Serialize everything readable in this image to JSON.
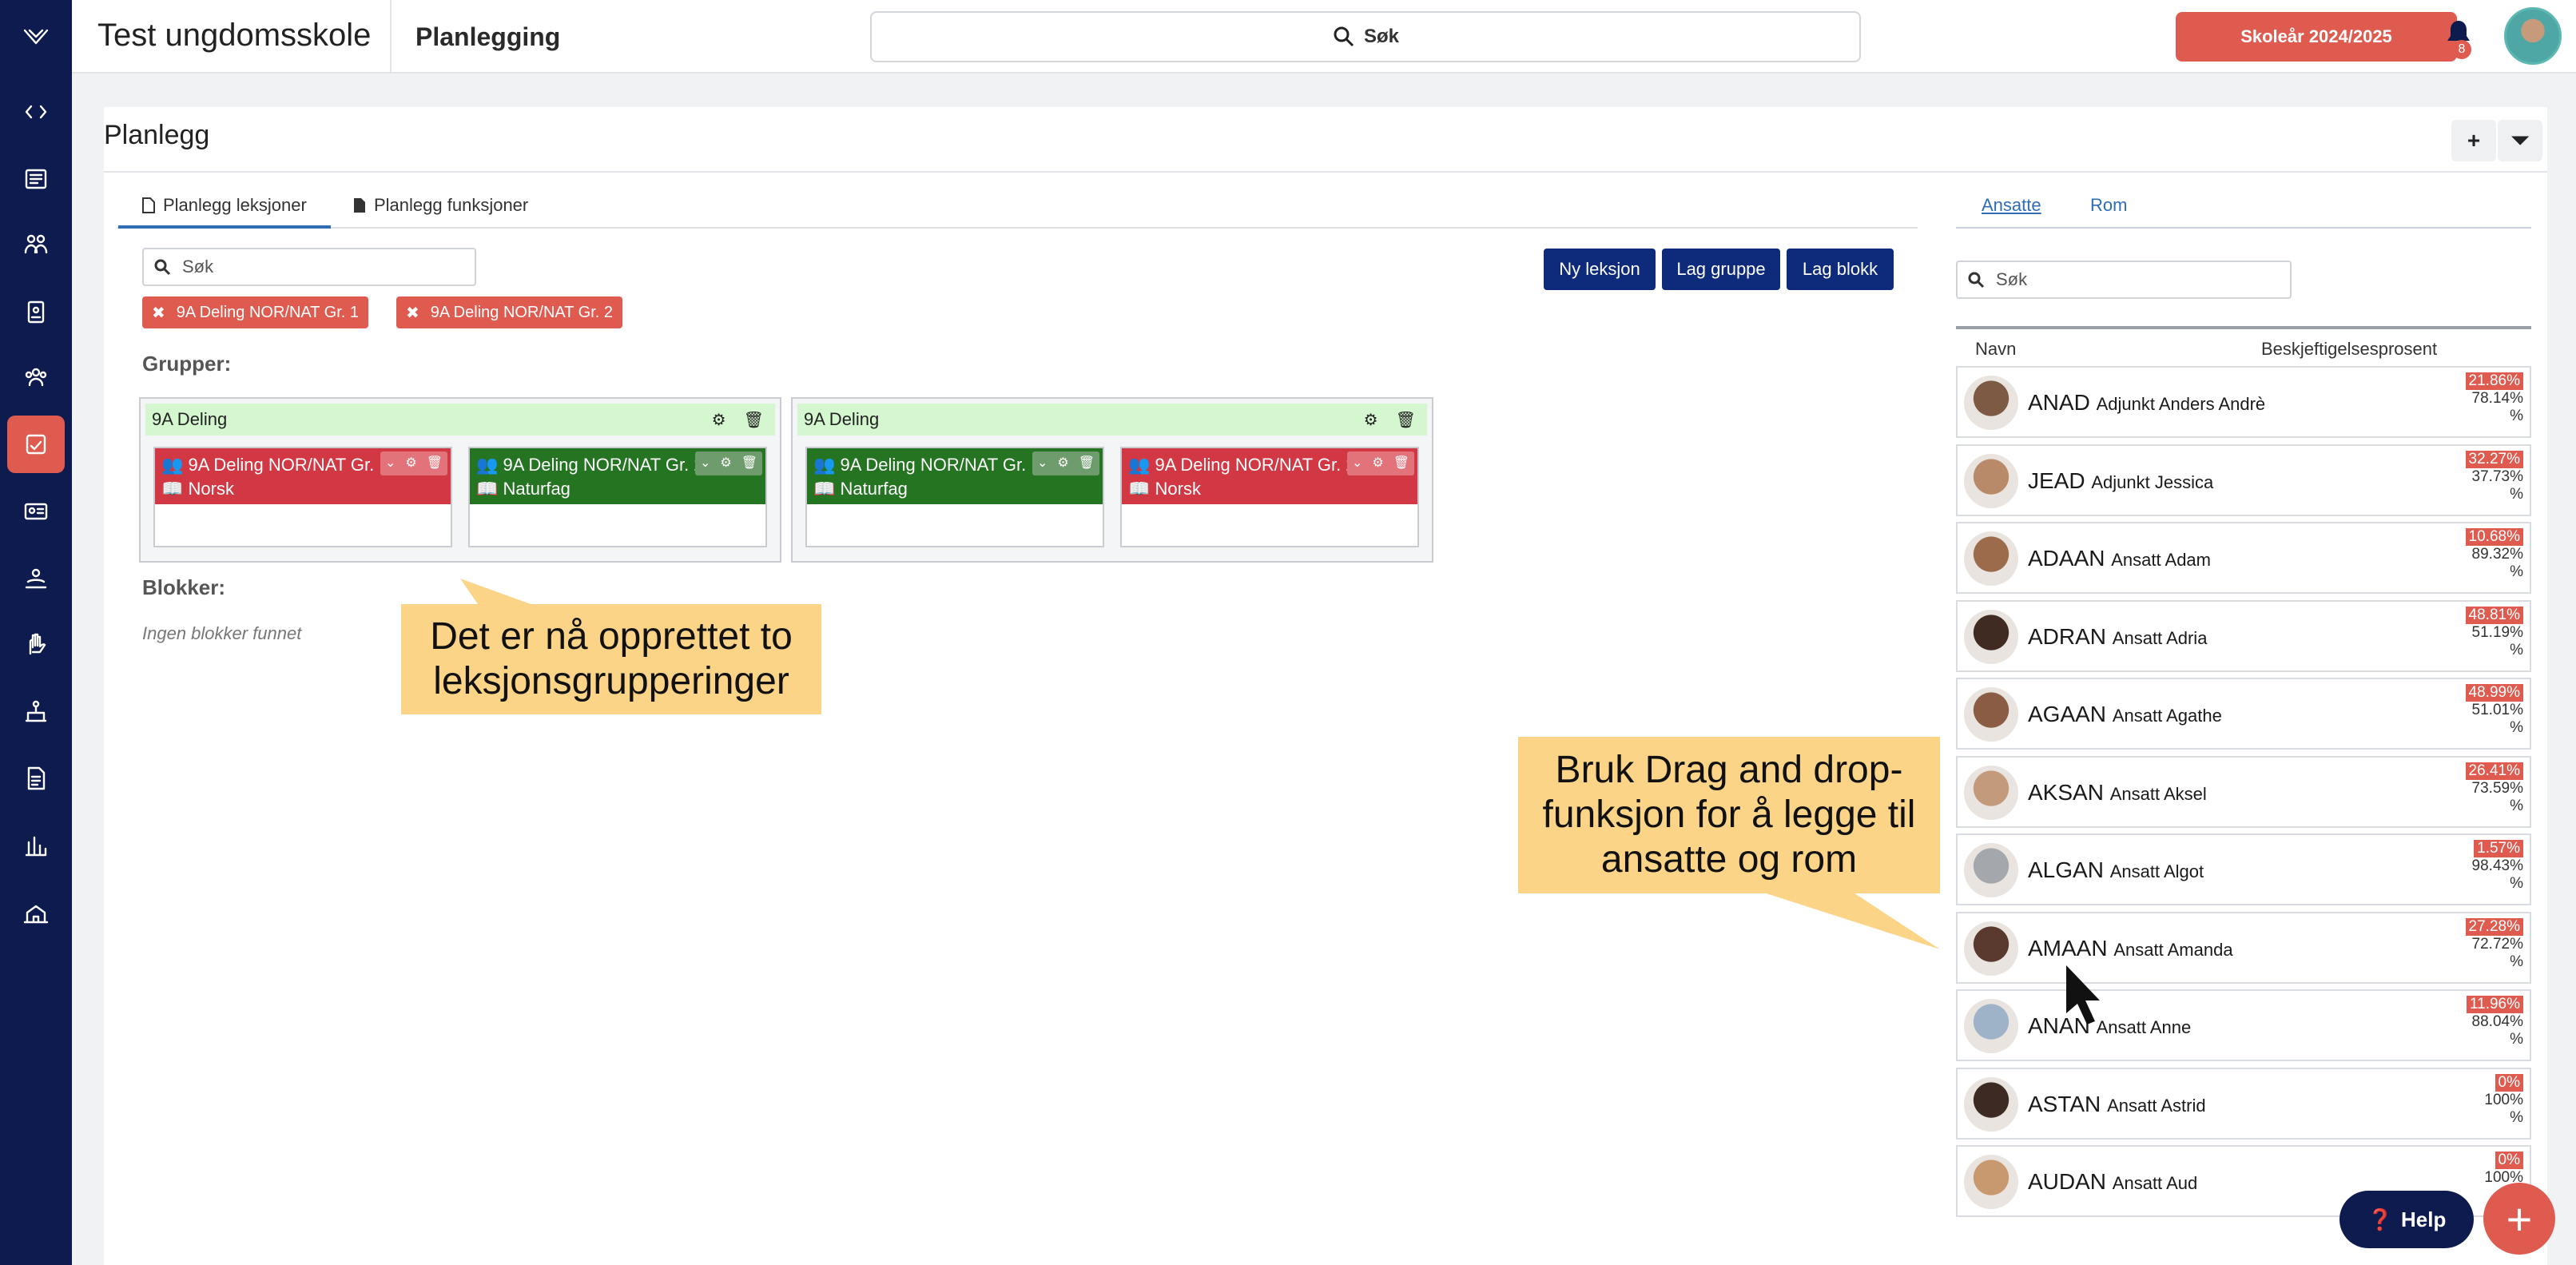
{
  "header": {
    "school_name": "Test ungdomsskole",
    "page_name": "Planlegging",
    "search_label": "Søk",
    "year_button": "Skoleår 2024/2025",
    "notification_count": "8"
  },
  "panel": {
    "title": "Planlegg",
    "add_label": "+",
    "filter_label": "⏷"
  },
  "tabs": [
    {
      "label": "Planlegg leksjoner"
    },
    {
      "label": "Planlegg funksjoner"
    }
  ],
  "filter": {
    "search_placeholder": "Søk",
    "chips": [
      {
        "label": "9A Deling NOR/NAT Gr. 1"
      },
      {
        "label": "9A Deling NOR/NAT Gr. 2"
      }
    ]
  },
  "actions": {
    "new_lesson": "Ny leksjon",
    "make_group": "Lag gruppe",
    "make_block": "Lag blokk"
  },
  "groups_label": "Grupper:",
  "groups": [
    {
      "name": "9A Deling",
      "lessons": [
        {
          "title": "9A Deling NOR/NAT Gr. 1",
          "subject": "Norsk",
          "color": "#d13843"
        },
        {
          "title": "9A Deling NOR/NAT Gr. 2",
          "subject": "Naturfag",
          "color": "#247422"
        }
      ]
    },
    {
      "name": "9A Deling",
      "lessons": [
        {
          "title": "9A Deling NOR/NAT Gr. 1",
          "subject": "Naturfag",
          "color": "#247422"
        },
        {
          "title": "9A Deling NOR/NAT Gr. 2",
          "subject": "Norsk",
          "color": "#d13843"
        }
      ]
    }
  ],
  "blocks": {
    "label": "Blokker:",
    "empty_text": "Ingen blokker funnet"
  },
  "callouts": {
    "groups_created": "Det er nå opprettet to leksjonsgrupperinger",
    "drag_drop": "Bruk Drag and drop-funksjon for å legge til ansatte og rom"
  },
  "staff_panel": {
    "tabs": [
      {
        "label": "Ansatte"
      },
      {
        "label": "Rom"
      }
    ],
    "search_placeholder": "Søk",
    "col_name": "Navn",
    "col_pct": "Beskjeftigelsesprosent",
    "employees": [
      {
        "code": "ANAD",
        "name": "Adjunkt Anders Andrè",
        "pct_a": "21.86%",
        "pct_b": "78.14%",
        "pct_unit": "%"
      },
      {
        "code": "JEAD",
        "name": "Adjunkt Jessica",
        "pct_a": "32.27%",
        "pct_b": "37.73%",
        "pct_unit": "%"
      },
      {
        "code": "ADAAN",
        "name": "Ansatt Adam",
        "pct_a": "10.68%",
        "pct_b": "89.32%",
        "pct_unit": "%"
      },
      {
        "code": "ADRAN",
        "name": "Ansatt Adria",
        "pct_a": "48.81%",
        "pct_b": "51.19%",
        "pct_unit": "%"
      },
      {
        "code": "AGAAN",
        "name": "Ansatt Agathe",
        "pct_a": "48.99%",
        "pct_b": "51.01%",
        "pct_unit": "%"
      },
      {
        "code": "AKSAN",
        "name": "Ansatt Aksel",
        "pct_a": "26.41%",
        "pct_b": "73.59%",
        "pct_unit": "%"
      },
      {
        "code": "ALGAN",
        "name": "Ansatt Algot",
        "pct_a": "1.57%",
        "pct_b": "98.43%",
        "pct_unit": "%"
      },
      {
        "code": "AMAAN",
        "name": "Ansatt Amanda",
        "pct_a": "27.28%",
        "pct_b": "72.72%",
        "pct_unit": "%"
      },
      {
        "code": "ANAN",
        "name": "Ansatt Anne",
        "pct_a": "11.96%",
        "pct_b": "88.04%",
        "pct_unit": "%"
      },
      {
        "code": "ASTAN",
        "name": "Ansatt Astrid",
        "pct_a": "0%",
        "pct_b": "100%",
        "pct_unit": "%"
      },
      {
        "code": "AUDAN",
        "name": "Ansatt Aud",
        "pct_a": "0%",
        "pct_b": "100%",
        "pct_unit": ""
      }
    ]
  },
  "help": {
    "label": "Help"
  },
  "colors": {
    "accent": "#e05b4f",
    "navy": "#0d1b4f",
    "button_blue": "#0e2a7a",
    "group_header": "#d4f7d0",
    "callout": "#fcd487"
  }
}
